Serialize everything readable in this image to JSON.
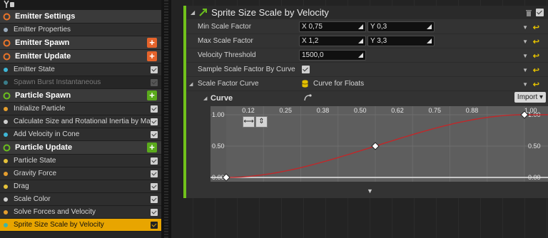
{
  "stack": {
    "rows": [
      {
        "kind": "header",
        "label": "Emitter Settings",
        "color": "#e8742a",
        "plus": false
      },
      {
        "kind": "item",
        "label": "Emitter Properties",
        "color": "#9ab",
        "check": false
      },
      {
        "kind": "header",
        "label": "Emitter Spawn",
        "color": "#e8742a",
        "plus": true,
        "plus_color": "#e5632b"
      },
      {
        "kind": "header",
        "label": "Emitter Update",
        "color": "#e8742a",
        "plus": true,
        "plus_color": "#e5632b"
      },
      {
        "kind": "item",
        "label": "Emitter State",
        "color": "#3fb6d6",
        "check": true
      },
      {
        "kind": "disabled",
        "label": "Spawn Burst Instantaneous",
        "color": "#3a7d8a",
        "check": true
      },
      {
        "kind": "header",
        "label": "Particle Spawn",
        "color": "#6bbd1e",
        "plus": true,
        "plus_color": "#5aaa1c"
      },
      {
        "kind": "item",
        "label": "Initialize Particle",
        "color": "#e59e2e",
        "check": true
      },
      {
        "kind": "item",
        "label": "Calculate Size and Rotational Inertia by Mass",
        "color": "#cfcfcf",
        "check": true
      },
      {
        "kind": "item",
        "label": "Add Velocity in Cone",
        "color": "#3fb6d6",
        "check": true
      },
      {
        "kind": "header",
        "label": "Particle Update",
        "color": "#6bbd1e",
        "plus": true,
        "plus_color": "#5aaa1c"
      },
      {
        "kind": "item",
        "label": "Particle State",
        "color": "#e5c23a",
        "check": true
      },
      {
        "kind": "item",
        "label": "Gravity Force",
        "color": "#e59e2e",
        "check": true
      },
      {
        "kind": "item",
        "label": "Drag",
        "color": "#e5c23a",
        "check": true
      },
      {
        "kind": "item",
        "label": "Scale Color",
        "color": "#cfcfcf",
        "check": true
      },
      {
        "kind": "item",
        "label": "Solve Forces and Velocity",
        "color": "#e59e2e",
        "check": true
      },
      {
        "kind": "selected",
        "label": "Sprite Size Scale by Velocity",
        "color": "#3fb6a6",
        "check": true
      }
    ]
  },
  "module": {
    "title": "Sprite Size Scale by Velocity",
    "props": {
      "min_scale": {
        "label": "Min Scale Factor",
        "x": "X 0,75",
        "y": "Y 0,3"
      },
      "max_scale": {
        "label": "Max Scale Factor",
        "x": "X 1,2",
        "y": "Y 3,3"
      },
      "vel_threshold": {
        "label": "Velocity Threshold",
        "value": "1500,0"
      },
      "sample_by_curve": {
        "label": "Sample Scale Factor By Curve"
      },
      "scale_curve": {
        "label": "Scale Factor Curve",
        "value": "Curve for Floats"
      },
      "curve": {
        "label": "Curve",
        "import": "Import"
      }
    }
  },
  "curve_editor": {
    "x_ticks": [
      "0.12",
      "0.25",
      "0.38",
      "0.50",
      "0.62",
      "0.75",
      "0.88",
      "1.00"
    ],
    "y_left": [
      "1.00",
      "0.50",
      "0.00"
    ],
    "y_right": [
      "1.00",
      "0.50",
      "0.00"
    ],
    "keys": [
      [
        0.0,
        0.0
      ],
      [
        0.5,
        0.5
      ],
      [
        1.0,
        1.0
      ]
    ],
    "curve_color": "#c0282a"
  },
  "colors": {
    "accent": "#e8a500",
    "module_bar": "#71c21b"
  }
}
